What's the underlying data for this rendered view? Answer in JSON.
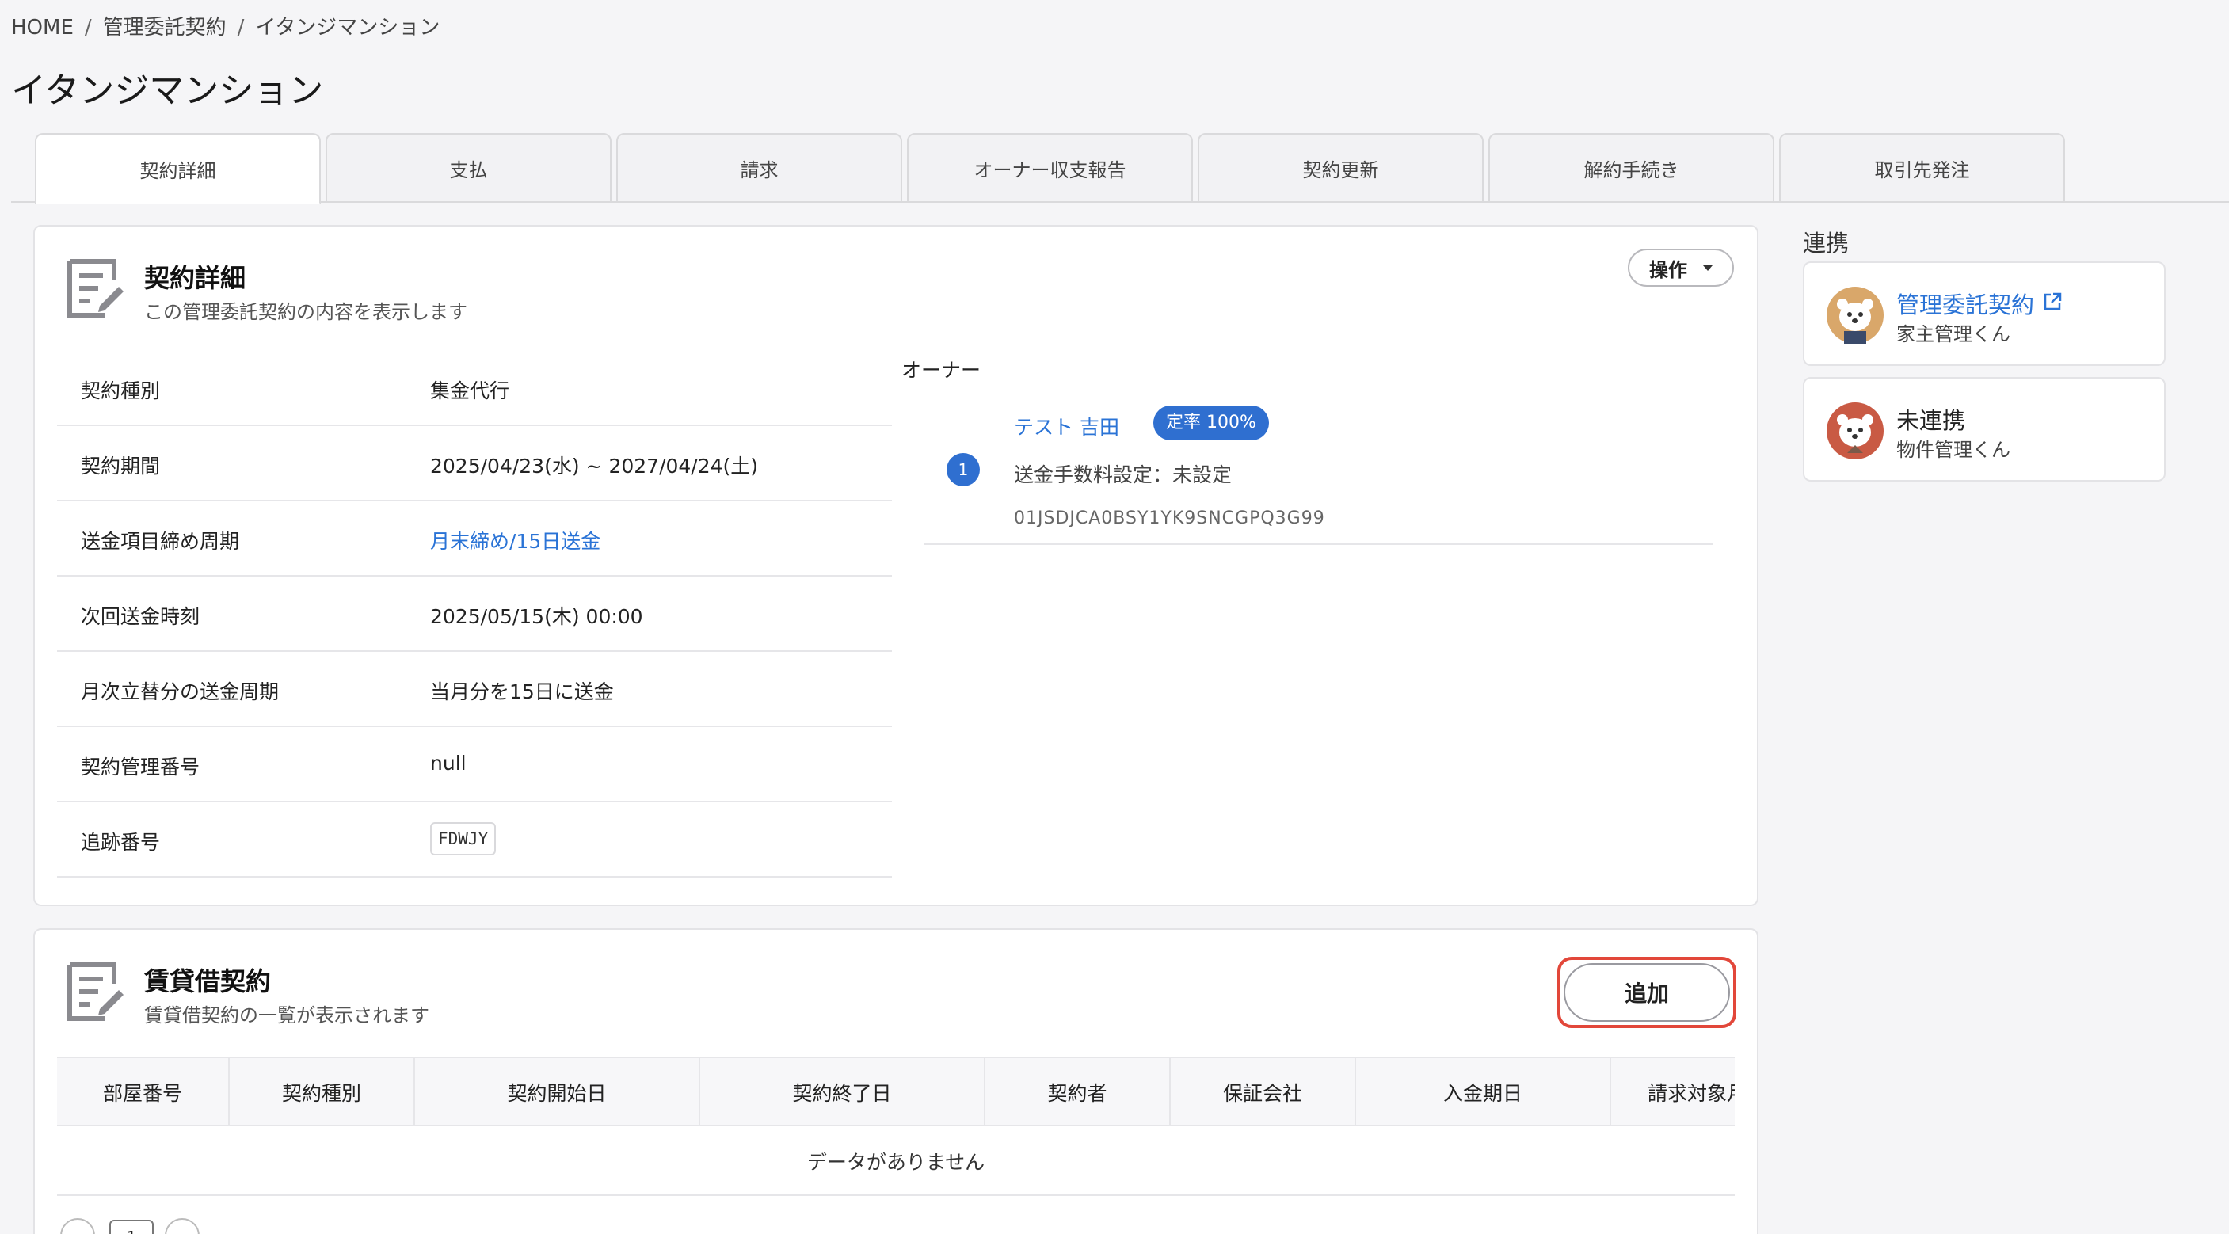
{
  "breadcrumb": {
    "items": [
      "HOME",
      "管理委託契約",
      "イタンジマンション"
    ],
    "separator": "/"
  },
  "page": {
    "title": "イタンジマンション"
  },
  "tabs": [
    {
      "label": "契約詳細",
      "active": true
    },
    {
      "label": "支払",
      "active": false
    },
    {
      "label": "請求",
      "active": false
    },
    {
      "label": "オーナー収支報告",
      "active": false
    },
    {
      "label": "契約更新",
      "active": false
    },
    {
      "label": "解約手続き",
      "active": false
    },
    {
      "label": "取引先発注",
      "active": false
    }
  ],
  "contract_card": {
    "title": "契約詳細",
    "subtitle": "この管理委託契約の内容を表示します",
    "ops_label": "操作",
    "rows": [
      {
        "label": "契約種別",
        "value": "集金代行"
      },
      {
        "label": "契約期間",
        "value": "2025/04/23(水) ~ 2027/04/24(土)"
      },
      {
        "label": "送金項目締め周期",
        "value": "月末締め/15日送金"
      },
      {
        "label": "次回送金時刻",
        "value": "2025/05/15(木) 00:00"
      },
      {
        "label": "月次立替分の送金周期",
        "value": "当月分を15日に送金"
      },
      {
        "label": "契約管理番号",
        "value": "null"
      },
      {
        "label": "追跡番号",
        "value": "FDWJY"
      }
    ],
    "owner": {
      "section_label": "オーナー",
      "number": "1",
      "name": "テスト 吉田",
      "badge": "定率 100%",
      "fee_text": "送金手数料設定：未設定",
      "id": "01JSDJCA0BSY1YK9SNCGPQ3G99"
    }
  },
  "lease_card": {
    "title": "賃貸借契約",
    "subtitle": "賃貸借契約の一覧が表示されます",
    "add_label": "追加",
    "columns": [
      "部屋番号",
      "契約種別",
      "契約開始日",
      "契約終了日",
      "契約者",
      "保証会社",
      "入金期日",
      "請求対象月"
    ],
    "empty_text": "データがありません",
    "page": "1"
  },
  "sidebar": {
    "title": "連携",
    "items": [
      {
        "title": "管理委託契約",
        "subtitle": "家主管理くん",
        "linked": true
      },
      {
        "title": "未連携",
        "subtitle": "物件管理くん",
        "linked": false
      }
    ]
  },
  "colors": {
    "accent": "#2f6fd0",
    "link": "#2a73d6",
    "highlight": "#e2473a"
  }
}
